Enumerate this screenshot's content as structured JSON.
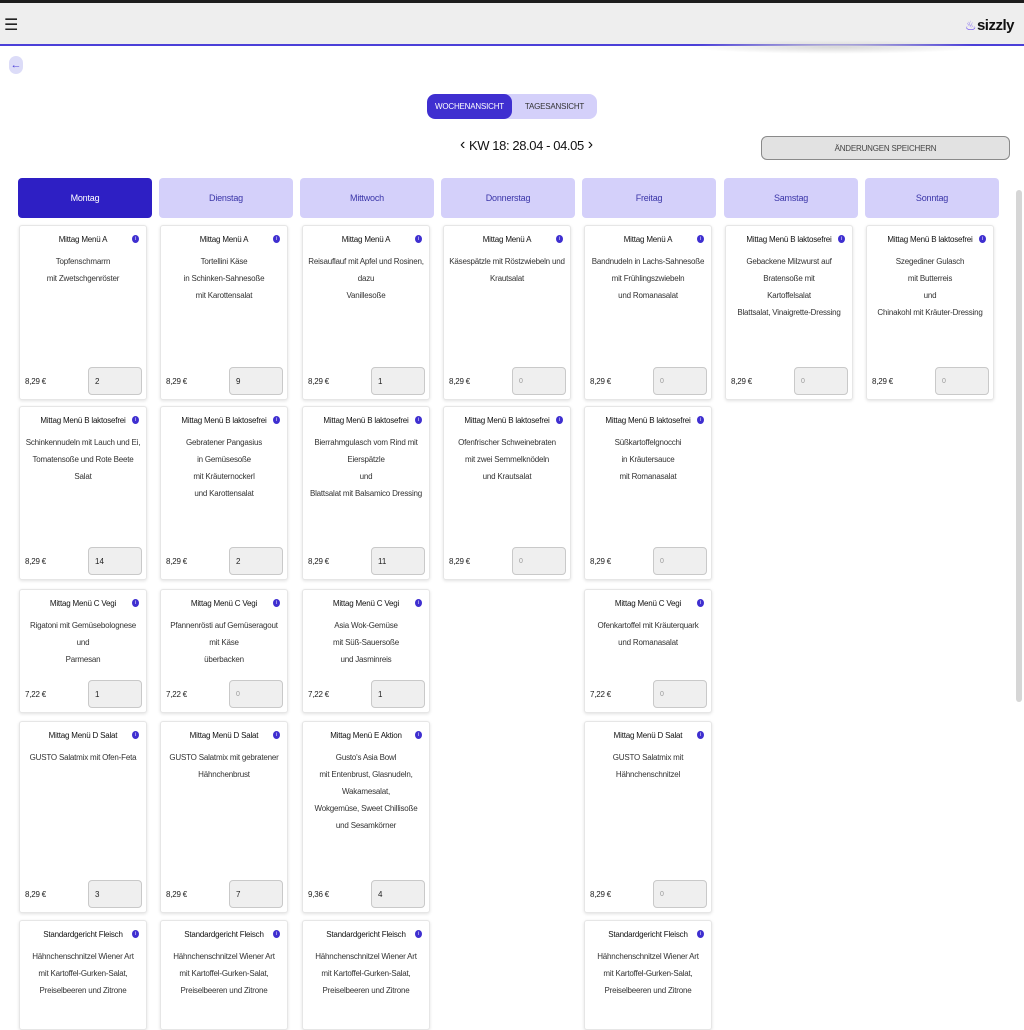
{
  "app": {
    "logo": "sizzly"
  },
  "view_toggle": {
    "week": "WOCHENANSICHT",
    "day": "TAGESANSICHT"
  },
  "week_label": "KW 18: 28.04 - 04.05",
  "save_button": "ÄNDERUNGEN SPEICHERN",
  "days": [
    "Montag",
    "Dienstag",
    "Mittwoch",
    "Donnerstag",
    "Freitag",
    "Samstag",
    "Sonntag"
  ],
  "columns": [
    [
      {
        "title": "Mittag Menü A",
        "desc": [
          "Topfenschmarrn",
          "mit Zwetschgenröster"
        ],
        "price": "8,29 €",
        "qty": "2"
      },
      {
        "title": "Mittag Menü B laktosefrei",
        "desc": [
          "Schinkennudeln mit Lauch und Ei,",
          "Tomatensoße und Rote Beete Salat"
        ],
        "price": "8,29 €",
        "qty": "14"
      },
      {
        "title": "Mittag Menü C Vegi",
        "desc": [
          "Rigatoni mit Gemüsebolognese und",
          "Parmesan"
        ],
        "price": "7,22 €",
        "qty": "1"
      },
      {
        "title": "Mittag Menü D Salat",
        "desc": [
          "GUSTO Salatmix mit Ofen-Feta"
        ],
        "price": "8,29 €",
        "qty": "3"
      },
      {
        "title": "Standardgericht Fleisch",
        "desc": [
          "Hähnchenschnitzel Wiener Art",
          "mit Kartoffel-Gurken-Salat,",
          "Preiselbeeren und Zitrone"
        ],
        "price": "",
        "qty": ""
      }
    ],
    [
      {
        "title": "Mittag Menü A",
        "desc": [
          "Tortellini Käse",
          "in Schinken-Sahnesoße",
          "mit Karottensalat"
        ],
        "price": "8,29 €",
        "qty": "9"
      },
      {
        "title": "Mittag Menü B laktosefrei",
        "desc": [
          "Gebratener Pangasius",
          "in Gemüsesoße",
          "mit Kräuternockerl",
          "und Karottensalat"
        ],
        "price": "8,29 €",
        "qty": "2"
      },
      {
        "title": "Mittag Menü C Vegi",
        "desc": [
          "Pfannenrösti auf Gemüseragout mit Käse",
          "überbacken"
        ],
        "price": "7,22 €",
        "qty": "0"
      },
      {
        "title": "Mittag Menü D Salat",
        "desc": [
          "GUSTO Salatmix mit gebratener",
          "Hähnchenbrust"
        ],
        "price": "8,29 €",
        "qty": "7"
      },
      {
        "title": "Standardgericht Fleisch",
        "desc": [
          "Hähnchenschnitzel Wiener Art",
          "mit Kartoffel-Gurken-Salat,",
          "Preiselbeeren und Zitrone"
        ],
        "price": "",
        "qty": ""
      }
    ],
    [
      {
        "title": "Mittag Menü A",
        "desc": [
          "Reisauflauf mit Apfel und Rosinen,",
          "dazu",
          "Vanillesoße"
        ],
        "price": "8,29 €",
        "qty": "1"
      },
      {
        "title": "Mittag Menü B laktosefrei",
        "desc": [
          "Bierrahmgulasch vom Rind mit Eierspätzle",
          "und",
          "Blattsalat mit Balsamico Dressing"
        ],
        "price": "8,29 €",
        "qty": "11"
      },
      {
        "title": "Mittag Menü C Vegi",
        "desc": [
          "Asia Wok-Gemüse",
          "mit Süß-Sauersoße",
          "und Jasminreis"
        ],
        "price": "7,22 €",
        "qty": "1"
      },
      {
        "title": "Mittag Menü E Aktion",
        "desc": [
          "Gusto's Asia Bowl",
          "mit Entenbrust, Glasnudeln, Wakamesalat,",
          "Wokgemüse, Sweet Chillisoße",
          "und Sesamkörner"
        ],
        "price": "9,36 €",
        "qty": "4"
      },
      {
        "title": "Standardgericht Fleisch",
        "desc": [
          "Hähnchenschnitzel Wiener Art",
          "mit Kartoffel-Gurken-Salat,",
          "Preiselbeeren und Zitrone"
        ],
        "price": "",
        "qty": ""
      }
    ],
    [
      {
        "title": "Mittag Menü A",
        "desc": [
          "Käsespätzle mit Röstzwiebeln und",
          "Krautsalat"
        ],
        "price": "8,29 €",
        "qty": "0"
      },
      {
        "title": "Mittag Menü B laktosefrei",
        "desc": [
          "Ofenfrischer Schweinebraten",
          "mit zwei Semmelknödeln",
          "und Krautsalat"
        ],
        "price": "8,29 €",
        "qty": "0"
      }
    ],
    [
      {
        "title": "Mittag Menü A",
        "desc": [
          "Bandnudeln in Lachs-Sahnesoße",
          "mit Frühlingszwiebeln",
          "und Romanasalat"
        ],
        "price": "8,29 €",
        "qty": "0"
      },
      {
        "title": "Mittag Menü B laktosefrei",
        "desc": [
          "Süßkartoffelgnocchi",
          "in Kräutersauce",
          "mit Romanasalat"
        ],
        "price": "8,29 €",
        "qty": "0"
      },
      {
        "title": "Mittag Menü C Vegi",
        "desc": [
          "Ofenkartoffel mit Kräuterquark",
          "und Romanasalat"
        ],
        "price": "7,22 €",
        "qty": "0"
      },
      {
        "title": "Mittag Menü D Salat",
        "desc": [
          "GUSTO Salatmix mit Hähnchenschnitzel"
        ],
        "price": "8,29 €",
        "qty": "0"
      },
      {
        "title": "Standardgericht Fleisch",
        "desc": [
          "Hähnchenschnitzel Wiener Art",
          "mit Kartoffel-Gurken-Salat,",
          "Preiselbeeren und Zitrone"
        ],
        "price": "",
        "qty": ""
      }
    ],
    [
      {
        "title": "Mittag Menü B laktosefrei",
        "desc": [
          "Gebackene Milzwurst auf Bratensoße mit",
          "Kartoffelsalat",
          "Blattsalat, Vinaigrette-Dressing"
        ],
        "price": "8,29 €",
        "qty": "0"
      }
    ],
    [
      {
        "title": "Mittag Menü B laktosefrei",
        "desc": [
          "Szegediner Gulasch",
          "mit Butterreis",
          "und",
          "Chinakohl mit Kräuter-Dressing"
        ],
        "price": "8,29 €",
        "qty": "0"
      }
    ]
  ],
  "active_day": 0,
  "accent_color": "#3f2fd0"
}
